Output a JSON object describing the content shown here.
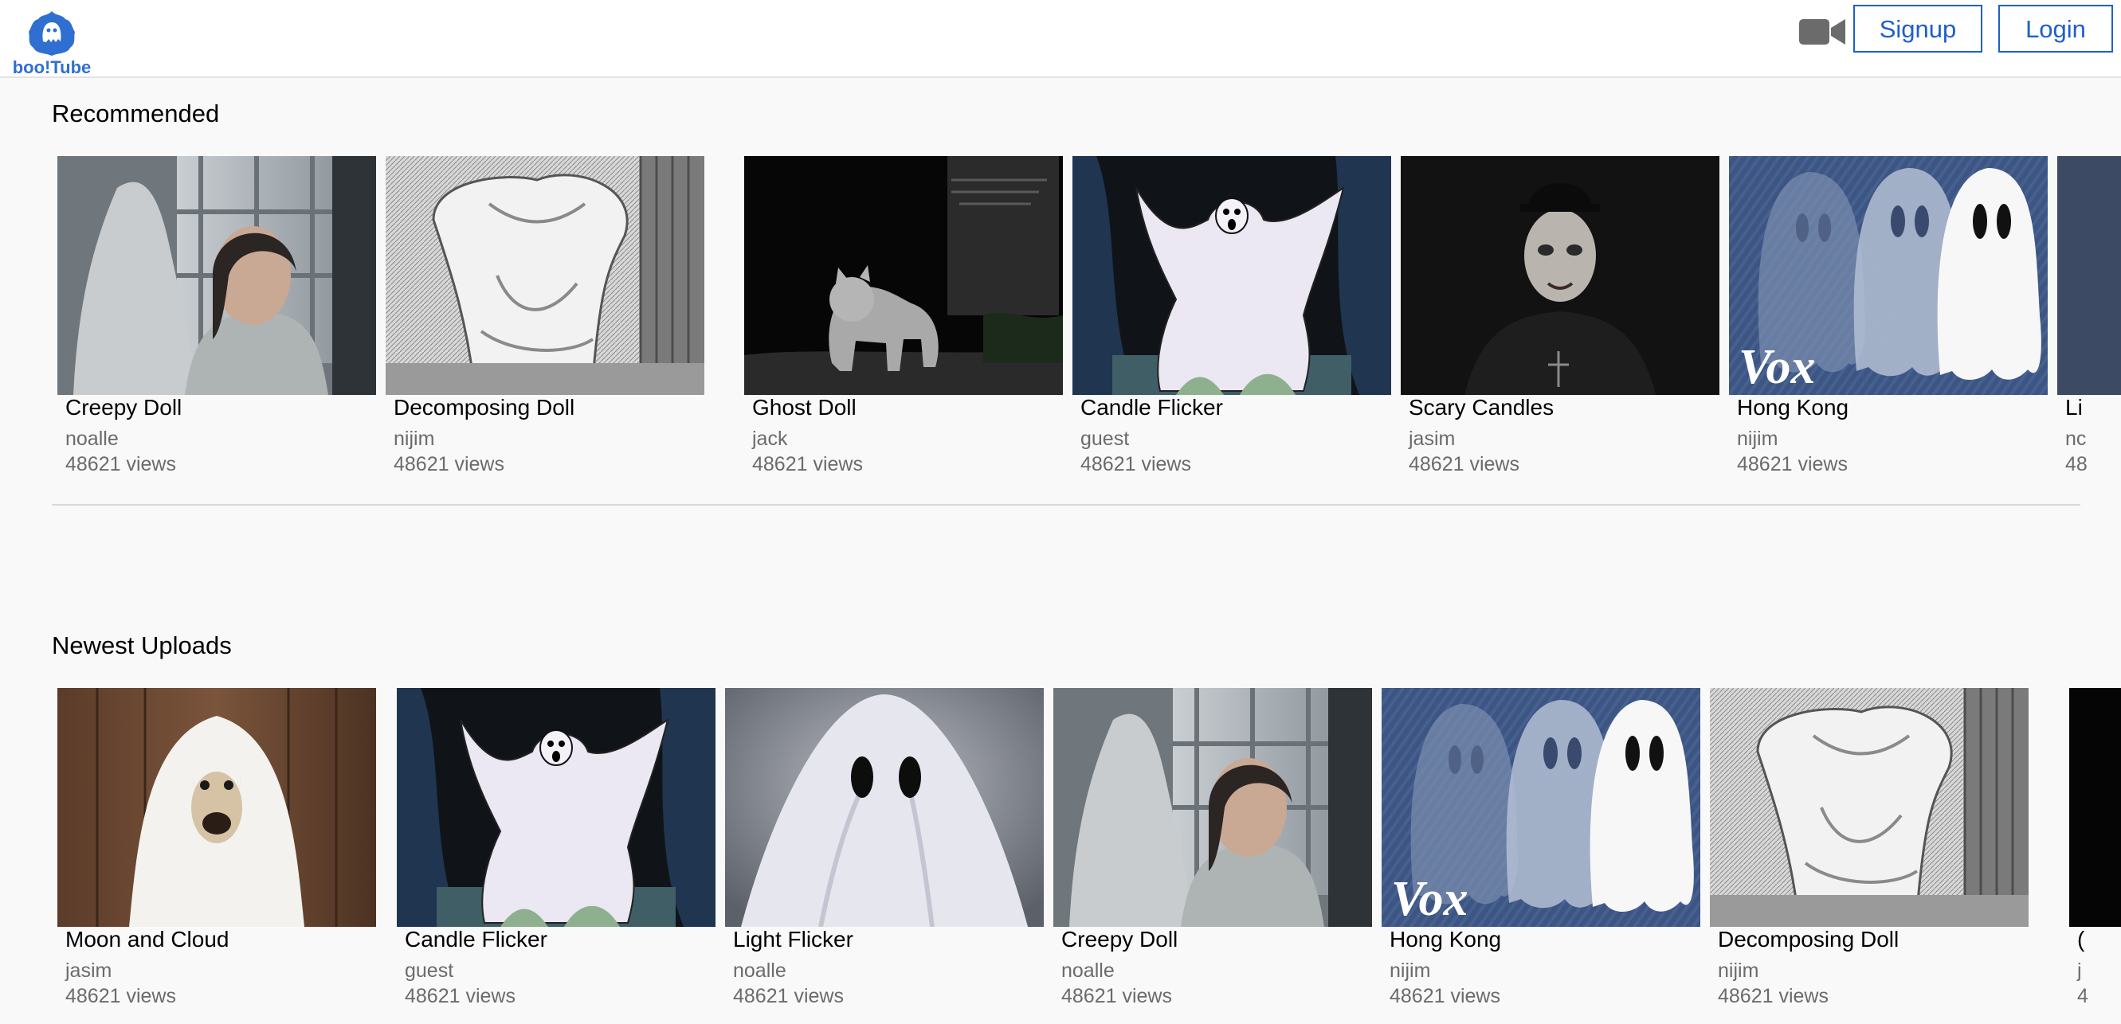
{
  "header": {
    "logo_text": "boo!Tube",
    "logo_icon": "ghost-icon",
    "camera_icon": "video-camera-icon",
    "signup_label": "Signup",
    "login_label": "Login",
    "accent_color": "#1e5fc9"
  },
  "sections": {
    "recommended": {
      "title": "Recommended",
      "videos": [
        {
          "title": "Creepy Doll",
          "author": "noalle",
          "views": "48621 views",
          "thumbnail": "sheet-ghost-and-woman"
        },
        {
          "title": "Decomposing Doll",
          "author": "nijim",
          "views": "48621 views",
          "thumbnail": "engraving-sheet-ghost"
        },
        {
          "title": "Ghost Doll",
          "author": "jack",
          "views": "48621 views",
          "thumbnail": "night-cat-graveyard"
        },
        {
          "title": "Candle Flicker",
          "author": "guest",
          "views": "48621 views",
          "thumbnail": "cartoon-ghost"
        },
        {
          "title": "Scary Candles",
          "author": "jasim",
          "views": "48621 views",
          "thumbnail": "dark-priest"
        },
        {
          "title": "Hong Kong",
          "author": "nijim",
          "views": "48621 views",
          "thumbnail": "vox-ghosts"
        },
        {
          "title": "Li",
          "author": "nc",
          "views": "48",
          "thumbnail": "partial"
        }
      ]
    },
    "newest": {
      "title": "Newest Uploads",
      "videos": [
        {
          "title": "Moon and Cloud",
          "author": "jasim",
          "views": "48621 views",
          "thumbnail": "dog-sheet-ghost"
        },
        {
          "title": "Candle Flicker",
          "author": "guest",
          "views": "48621 views",
          "thumbnail": "cartoon-ghost"
        },
        {
          "title": "Light Flicker",
          "author": "noalle",
          "views": "48621 views",
          "thumbnail": "sheet-ghost-closeup"
        },
        {
          "title": "Creepy Doll",
          "author": "noalle",
          "views": "48621 views",
          "thumbnail": "sheet-ghost-and-woman"
        },
        {
          "title": "Hong Kong",
          "author": "nijim",
          "views": "48621 views",
          "thumbnail": "vox-ghosts"
        },
        {
          "title": "Decomposing Doll",
          "author": "nijim",
          "views": "48621 views",
          "thumbnail": "engraving-sheet-ghost"
        },
        {
          "title": "(",
          "author": "j",
          "views": "4",
          "thumbnail": "partial"
        }
      ]
    }
  },
  "thumbnail_brand_text": "Vox"
}
